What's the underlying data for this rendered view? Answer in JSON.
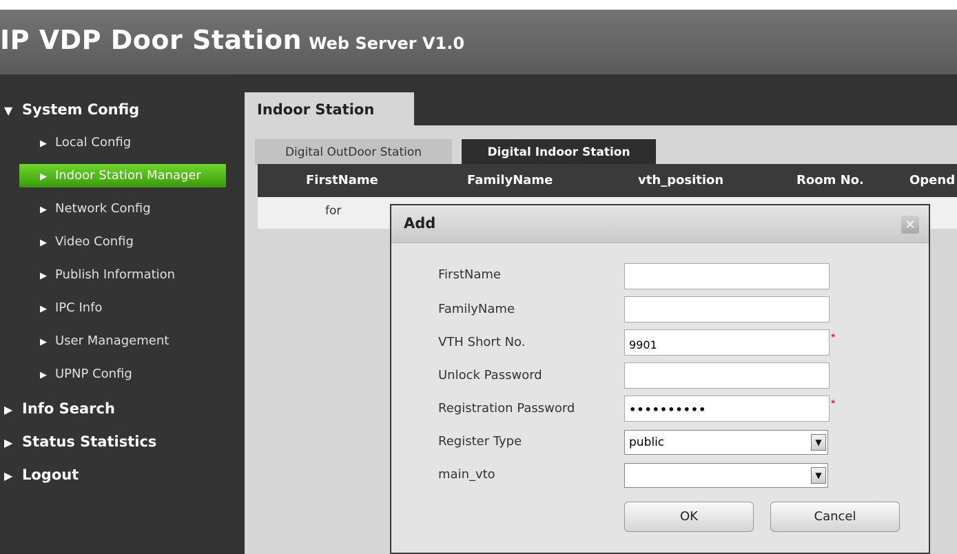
{
  "header": {
    "title": "IP VDP Door Station",
    "subtitle": "Web Server V1.0"
  },
  "sidebar": {
    "sections": [
      {
        "label": "System Config",
        "expanded": true
      },
      {
        "label": "Info Search",
        "expanded": false
      },
      {
        "label": "Status Statistics",
        "expanded": false
      },
      {
        "label": "Logout",
        "expanded": false
      }
    ],
    "items": [
      {
        "label": "Local Config"
      },
      {
        "label": "Indoor Station Manager",
        "active": true
      },
      {
        "label": "Network Config"
      },
      {
        "label": "Video Config"
      },
      {
        "label": "Publish Information"
      },
      {
        "label": "IPC Info"
      },
      {
        "label": "User Management"
      },
      {
        "label": "UPNP Config"
      }
    ]
  },
  "main": {
    "tab": "Indoor Station",
    "subtabs": [
      {
        "label": "Digital OutDoor Station",
        "active": false
      },
      {
        "label": "Digital Indoor Station",
        "active": true
      }
    ],
    "table": {
      "columns": [
        "FirstName",
        "FamilyName",
        "vth_position",
        "Room No.",
        "Opend"
      ],
      "rows": [
        [
          "for"
        ]
      ]
    }
  },
  "dialog": {
    "title": "Add",
    "close_glyph": "✕",
    "fields": [
      {
        "label": "FirstName",
        "value": "",
        "required": false
      },
      {
        "label": "FamilyName",
        "value": "",
        "required": false
      },
      {
        "label": "VTH Short No.",
        "value": "9901",
        "required": true
      },
      {
        "label": "Unlock Password",
        "value": "",
        "required": false
      },
      {
        "label": "Registration Password",
        "value": "••••••••••",
        "required": true
      },
      {
        "label": "Register Type",
        "value": "public",
        "required": false
      },
      {
        "label": "main_vto",
        "value": "",
        "required": false
      }
    ],
    "required_mark": "*",
    "ok_label": "OK",
    "cancel_label": "Cancel",
    "dropdown_glyph": "▼"
  },
  "glyphs": {
    "expanded": "▼",
    "collapsed": "▶",
    "item": "▶"
  },
  "colors": {
    "active_nav": "#4caf1a",
    "header_bg": "#666666",
    "required": "#e00000"
  }
}
